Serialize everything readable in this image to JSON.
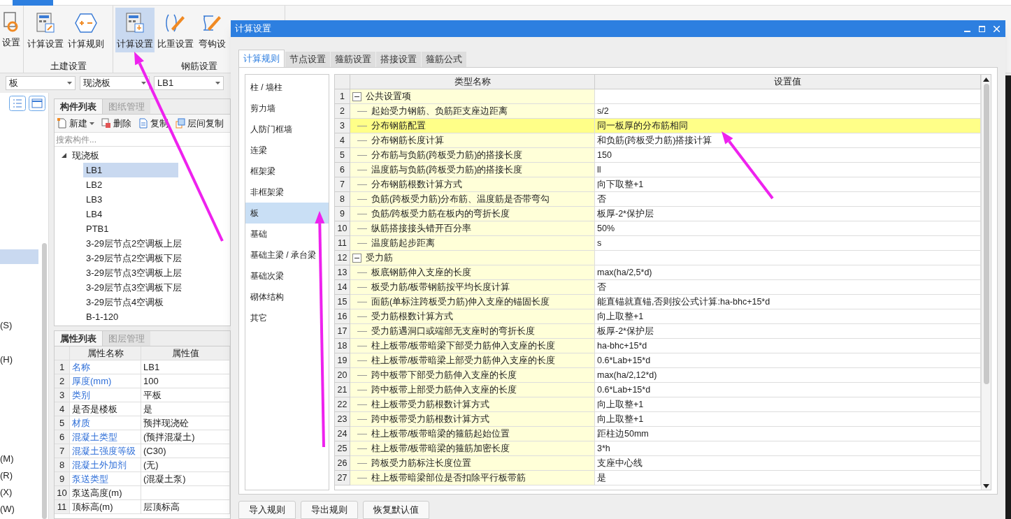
{
  "ribbon": {
    "groups": [
      {
        "buttons": [
          {
            "label": "设置",
            "selected": false
          }
        ]
      },
      {
        "label": "土建设置",
        "buttons": [
          {
            "label": "计算设置",
            "selected": false
          },
          {
            "label": "计算规则",
            "selected": false
          }
        ]
      },
      {
        "label": "钢筋设置",
        "buttons": [
          {
            "label": "计算设置",
            "selected": true
          },
          {
            "label": "比重设置",
            "selected": false
          },
          {
            "label": "弯钩设",
            "selected": false
          }
        ]
      }
    ]
  },
  "filters": [
    "板",
    "现浇板",
    "LB1"
  ],
  "left_strip": {
    "items": [
      "(S)",
      "(H)",
      "(M)",
      "(R)",
      "(X)",
      "(W)"
    ]
  },
  "component_panel": {
    "tabs": [
      {
        "label": "构件列表",
        "selected": true
      },
      {
        "label": "图纸管理",
        "selected": false
      }
    ],
    "toolbar": [
      "新建",
      "删除",
      "复制",
      "层间复制"
    ],
    "search": {
      "placeholder": "搜索构件..."
    },
    "tree": [
      {
        "label": "现浇板",
        "expanded": true,
        "selected": false,
        "children": [
          {
            "label": "LB1",
            "selected": true
          },
          {
            "label": "LB2",
            "selected": false
          },
          {
            "label": "LB3",
            "selected": false
          },
          {
            "label": "LB4",
            "selected": false
          },
          {
            "label": "PTB1",
            "selected": false
          },
          {
            "label": "3-29层节点2空调板上层",
            "selected": false
          },
          {
            "label": "3-29层节点2空调板下层",
            "selected": false
          },
          {
            "label": "3-29层节点3空调板上层",
            "selected": false
          },
          {
            "label": "3-29层节点3空调板下层",
            "selected": false
          },
          {
            "label": "3-29层节点4空调板",
            "selected": false
          },
          {
            "label": "B-1-120",
            "selected": false
          }
        ]
      }
    ]
  },
  "property_panel": {
    "tabs": [
      {
        "label": "属性列表",
        "selected": true
      },
      {
        "label": "图层管理",
        "selected": false
      }
    ],
    "columns": [
      "属性名称",
      "属性值"
    ],
    "rows": [
      {
        "num": "1",
        "name": "名称",
        "value": "LB1",
        "linked": true
      },
      {
        "num": "2",
        "name": "厚度(mm)",
        "value": "100",
        "linked": true
      },
      {
        "num": "3",
        "name": "类别",
        "value": "平板",
        "linked": true
      },
      {
        "num": "4",
        "name": "是否是楼板",
        "value": "是",
        "linked": false
      },
      {
        "num": "5",
        "name": "材质",
        "value": "预拌现浇砼",
        "linked": true
      },
      {
        "num": "6",
        "name": "混凝土类型",
        "value": "(预拌混凝土)",
        "linked": true
      },
      {
        "num": "7",
        "name": "混凝土强度等级",
        "value": "(C30)",
        "linked": true
      },
      {
        "num": "8",
        "name": "混凝土外加剂",
        "value": "(无)",
        "linked": true
      },
      {
        "num": "9",
        "name": "泵送类型",
        "value": "(混凝土泵)",
        "linked": true
      },
      {
        "num": "10",
        "name": "泵送高度(m)",
        "linked": false
      },
      {
        "num": "11",
        "name": "顶标高(m)",
        "value": "层顶标高",
        "linked": false
      }
    ]
  },
  "dialog": {
    "title": "计算设置",
    "tabs": [
      {
        "label": "计算规则",
        "selected": true
      },
      {
        "label": "节点设置",
        "selected": false
      },
      {
        "label": "箍筋设置",
        "selected": false
      },
      {
        "label": "搭接设置",
        "selected": false
      },
      {
        "label": "箍筋公式",
        "selected": false
      }
    ],
    "categories": [
      {
        "label": "柱 / 墙柱",
        "selected": false
      },
      {
        "label": "剪力墙",
        "selected": false
      },
      {
        "label": "人防门框墙",
        "selected": false
      },
      {
        "label": "连梁",
        "selected": false
      },
      {
        "label": "框架梁",
        "selected": false
      },
      {
        "label": "非框架梁",
        "selected": false
      },
      {
        "label": "板",
        "selected": true
      },
      {
        "label": "基础",
        "selected": false
      },
      {
        "label": "基础主梁 / 承台梁",
        "selected": false
      },
      {
        "label": "基础次梁",
        "selected": false
      },
      {
        "label": "砌体结构",
        "selected": false
      },
      {
        "label": "其它",
        "selected": false
      }
    ],
    "table": {
      "columns": [
        "类型名称",
        "设置值"
      ],
      "rows": [
        {
          "num": "1",
          "kind": "group",
          "name": "公共设置项",
          "expanded": true,
          "selected": false
        },
        {
          "num": "2",
          "kind": "setting",
          "name": "起始受力钢筋、负筋距支座边距离",
          "value": "s/2",
          "selected": false
        },
        {
          "num": "3",
          "kind": "setting",
          "name": "分布钢筋配置",
          "value": "同一板厚的分布筋相同",
          "selected": true
        },
        {
          "num": "4",
          "kind": "setting",
          "name": "分布钢筋长度计算",
          "value": "和负筋(跨板受力筋)搭接计算",
          "selected": false
        },
        {
          "num": "5",
          "kind": "setting",
          "name": "分布筋与负筋(跨板受力筋)的搭接长度",
          "value": "150",
          "selected": false
        },
        {
          "num": "6",
          "kind": "setting",
          "name": "温度筋与负筋(跨板受力筋)的搭接长度",
          "value": "ll",
          "selected": false
        },
        {
          "num": "7",
          "kind": "setting",
          "name": "分布钢筋根数计算方式",
          "value": "向下取整+1",
          "selected": false
        },
        {
          "num": "8",
          "kind": "setting",
          "name": "负筋(跨板受力筋)分布筋、温度筋是否带弯勾",
          "value": "否",
          "selected": false
        },
        {
          "num": "9",
          "kind": "setting",
          "name": "负筋/跨板受力筋在板内的弯折长度",
          "value": "板厚-2*保护层",
          "selected": false
        },
        {
          "num": "10",
          "kind": "setting",
          "name": "纵筋搭接接头错开百分率",
          "value": "50%",
          "selected": false
        },
        {
          "num": "11",
          "kind": "setting",
          "name": "温度筋起步距离",
          "value": "s",
          "selected": false
        },
        {
          "num": "12",
          "kind": "group",
          "name": "受力筋",
          "expanded": true,
          "selected": false
        },
        {
          "num": "13",
          "kind": "setting",
          "name": "板底钢筋伸入支座的长度",
          "value": "max(ha/2,5*d)",
          "selected": false
        },
        {
          "num": "14",
          "kind": "setting",
          "name": "板受力筋/板带钢筋按平均长度计算",
          "value": "否",
          "selected": false
        },
        {
          "num": "15",
          "kind": "setting",
          "name": "面筋(单标注跨板受力筋)伸入支座的锚固长度",
          "value": "能直锚就直锚,否则按公式计算:ha-bhc+15*d",
          "selected": false
        },
        {
          "num": "16",
          "kind": "setting",
          "name": "受力筋根数计算方式",
          "value": "向上取整+1",
          "selected": false
        },
        {
          "num": "17",
          "kind": "setting",
          "name": "受力筋遇洞口或端部无支座时的弯折长度",
          "value": "板厚-2*保护层",
          "selected": false
        },
        {
          "num": "18",
          "kind": "setting",
          "name": "柱上板带/板带暗梁下部受力筋伸入支座的长度",
          "value": "ha-bhc+15*d",
          "selected": false
        },
        {
          "num": "19",
          "kind": "setting",
          "name": "柱上板带/板带暗梁上部受力筋伸入支座的长度",
          "value": "0.6*Lab+15*d",
          "selected": false
        },
        {
          "num": "20",
          "kind": "setting",
          "name": "跨中板带下部受力筋伸入支座的长度",
          "value": "max(ha/2,12*d)",
          "selected": false
        },
        {
          "num": "21",
          "kind": "setting",
          "name": "跨中板带上部受力筋伸入支座的长度",
          "value": "0.6*Lab+15*d",
          "selected": false
        },
        {
          "num": "22",
          "kind": "setting",
          "name": "柱上板带受力筋根数计算方式",
          "value": "向上取整+1",
          "selected": false
        },
        {
          "num": "23",
          "kind": "setting",
          "name": "跨中板带受力筋根数计算方式",
          "value": "向上取整+1",
          "selected": false
        },
        {
          "num": "24",
          "kind": "setting",
          "name": "柱上板带/板带暗梁的箍筋起始位置",
          "value": "距柱边50mm",
          "selected": false
        },
        {
          "num": "25",
          "kind": "setting",
          "name": "柱上板带/板带暗梁的箍筋加密长度",
          "value": "3*h",
          "selected": false
        },
        {
          "num": "26",
          "kind": "setting",
          "name": "跨板受力筋标注长度位置",
          "value": "支座中心线",
          "selected": false
        },
        {
          "num": "27",
          "kind": "setting",
          "name": "柱上板带暗梁部位是否扣除平行板带筋",
          "value": "是",
          "selected": false
        }
      ]
    },
    "buttons": [
      "导入规则",
      "导出规则",
      "恢复默认值"
    ]
  }
}
